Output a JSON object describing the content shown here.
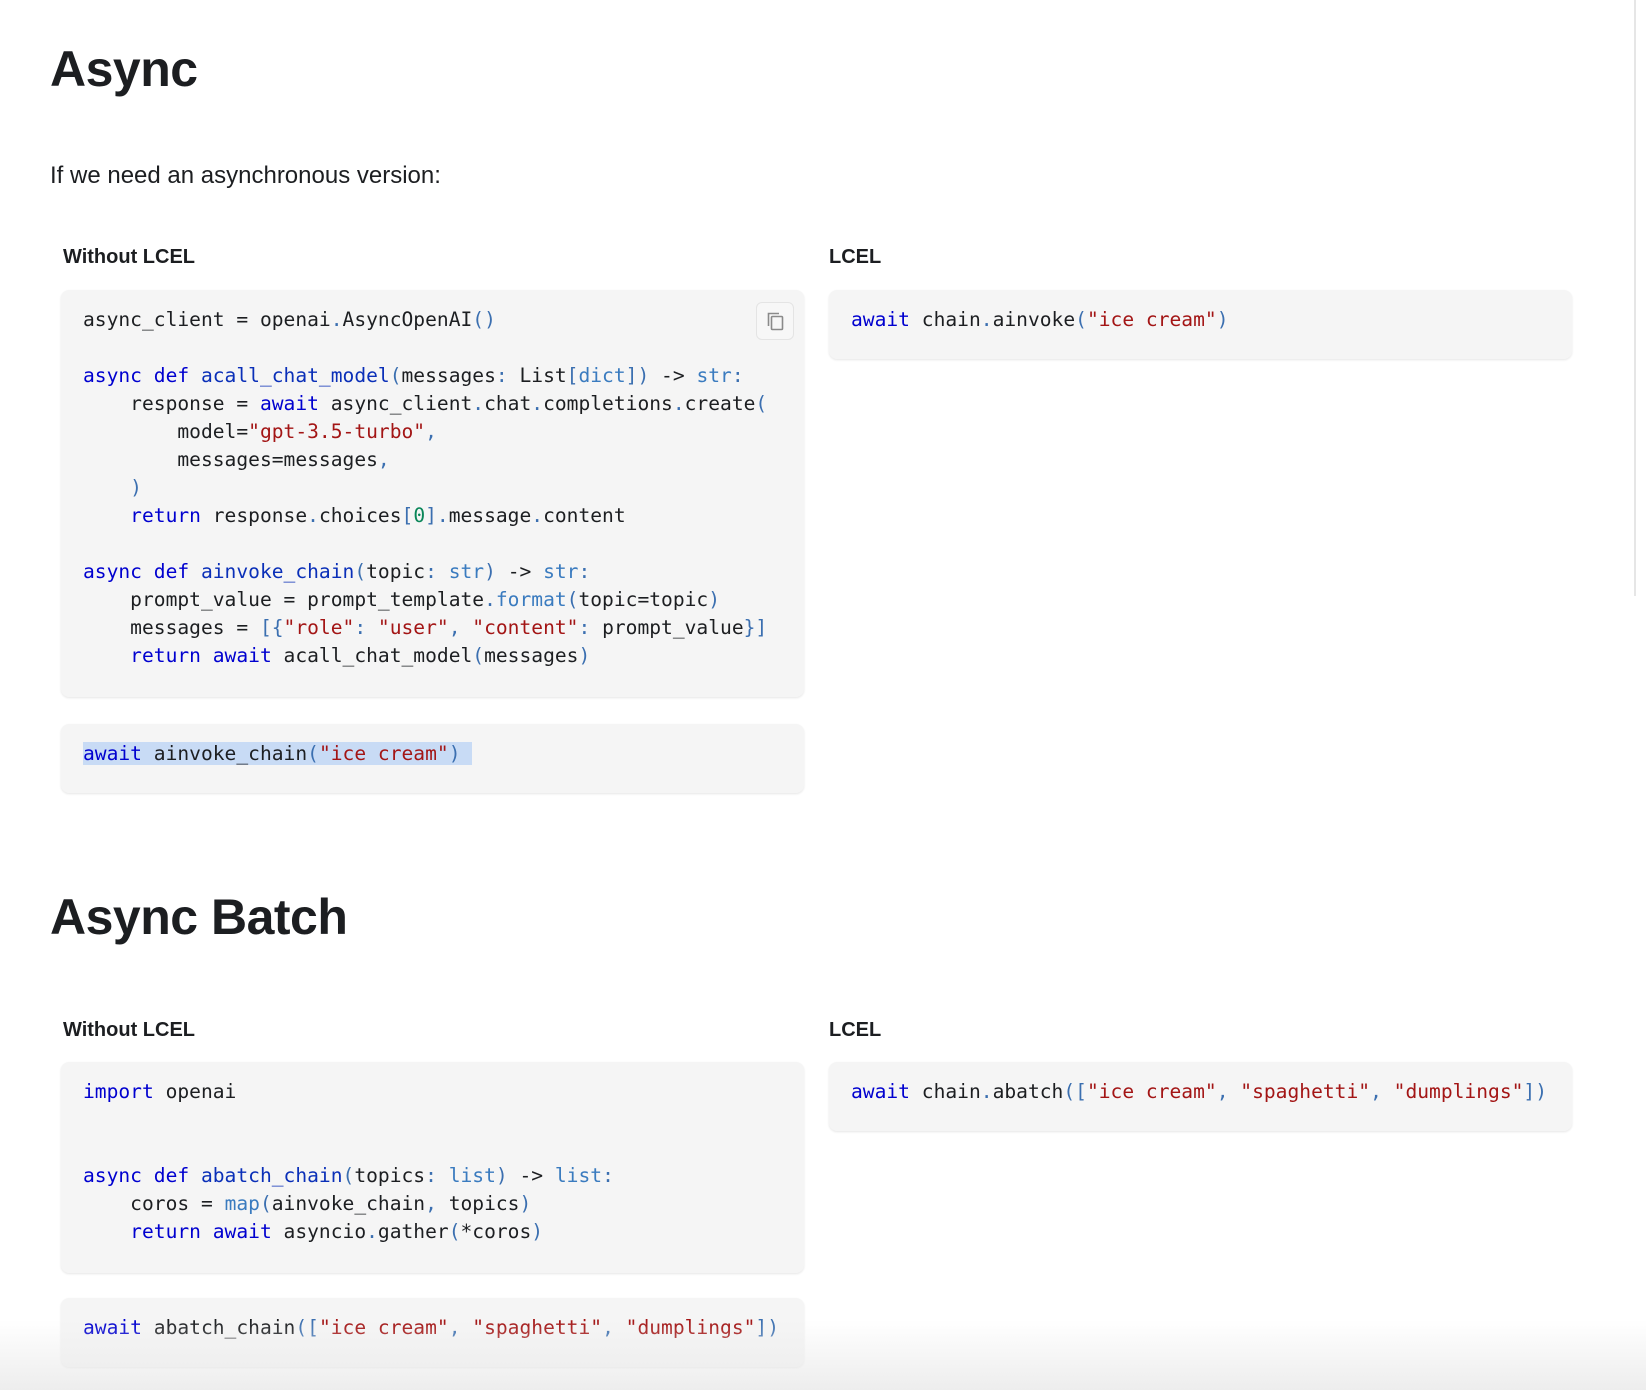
{
  "sections": {
    "async": {
      "title": "Async",
      "intro": "If we need an asynchronous version:",
      "without_label": "Without LCEL",
      "lcel_label": "LCEL"
    },
    "async_batch": {
      "title": "Async Batch",
      "without_label": "Without LCEL",
      "lcel_label": "LCEL"
    }
  },
  "code_blocks": {
    "async_without_lcel": [
      [
        [
          "t",
          "async_client = openai"
        ],
        [
          "p",
          "."
        ],
        [
          "t",
          "AsyncOpenAI"
        ],
        [
          "p",
          "()"
        ]
      ],
      [],
      [
        [
          "k",
          "async def "
        ],
        [
          "f",
          "acall_chat_model"
        ],
        [
          "p",
          "("
        ],
        [
          "t",
          "messages"
        ],
        [
          "p",
          ": "
        ],
        [
          "t",
          "List"
        ],
        [
          "p",
          "["
        ],
        [
          "b",
          "dict"
        ],
        [
          "p",
          "]) "
        ],
        [
          "t",
          "-> "
        ],
        [
          "b",
          "str"
        ],
        [
          "p",
          ":"
        ]
      ],
      [
        [
          "t",
          "    response = "
        ],
        [
          "k",
          "await "
        ],
        [
          "t",
          "async_client"
        ],
        [
          "p",
          "."
        ],
        [
          "t",
          "chat"
        ],
        [
          "p",
          "."
        ],
        [
          "t",
          "completions"
        ],
        [
          "p",
          "."
        ],
        [
          "t",
          "create"
        ],
        [
          "p",
          "("
        ]
      ],
      [
        [
          "t",
          "        model="
        ],
        [
          "s",
          "\"gpt-3.5-turbo\""
        ],
        [
          "p",
          ","
        ]
      ],
      [
        [
          "t",
          "        messages=messages"
        ],
        [
          "p",
          ","
        ]
      ],
      [
        [
          "p",
          "    )"
        ]
      ],
      [
        [
          "k",
          "    return "
        ],
        [
          "t",
          "response"
        ],
        [
          "p",
          "."
        ],
        [
          "t",
          "choices"
        ],
        [
          "p",
          "["
        ],
        [
          "n",
          "0"
        ],
        [
          "p",
          "]."
        ],
        [
          "t",
          "message"
        ],
        [
          "p",
          "."
        ],
        [
          "t",
          "content"
        ]
      ],
      [],
      [
        [
          "k",
          "async def "
        ],
        [
          "f",
          "ainvoke_chain"
        ],
        [
          "p",
          "("
        ],
        [
          "t",
          "topic"
        ],
        [
          "p",
          ": "
        ],
        [
          "b",
          "str"
        ],
        [
          "p",
          ") "
        ],
        [
          "t",
          "-> "
        ],
        [
          "b",
          "str"
        ],
        [
          "p",
          ":"
        ]
      ],
      [
        [
          "t",
          "    prompt_value = prompt_template"
        ],
        [
          "p",
          "."
        ],
        [
          "b",
          "format"
        ],
        [
          "p",
          "("
        ],
        [
          "t",
          "topic=topic"
        ],
        [
          "p",
          ")"
        ]
      ],
      [
        [
          "t",
          "    messages = "
        ],
        [
          "p",
          "[{"
        ],
        [
          "s",
          "\"role\""
        ],
        [
          "p",
          ": "
        ],
        [
          "s",
          "\"user\""
        ],
        [
          "p",
          ", "
        ],
        [
          "s",
          "\"content\""
        ],
        [
          "p",
          ": "
        ],
        [
          "t",
          "prompt_value"
        ],
        [
          "p",
          "}]"
        ]
      ],
      [
        [
          "k",
          "    return await "
        ],
        [
          "t",
          "acall_chat_model"
        ],
        [
          "p",
          "("
        ],
        [
          "t",
          "messages"
        ],
        [
          "p",
          ")"
        ]
      ]
    ],
    "async_without_lcel_call": [
      [
        [
          "k",
          "await "
        ],
        [
          "t",
          "ainvoke_chain"
        ],
        [
          "p",
          "("
        ],
        [
          "s",
          "\"ice cream\""
        ],
        [
          "p",
          ")"
        ],
        [
          "t",
          " "
        ]
      ]
    ],
    "async_lcel": [
      [
        [
          "k",
          "await "
        ],
        [
          "t",
          "chain"
        ],
        [
          "p",
          "."
        ],
        [
          "t",
          "ainvoke"
        ],
        [
          "p",
          "("
        ],
        [
          "s",
          "\"ice cream\""
        ],
        [
          "p",
          ")"
        ]
      ]
    ],
    "batch_without_lcel": [
      [
        [
          "k",
          "import "
        ],
        [
          "t",
          "openai"
        ]
      ],
      [],
      [],
      [
        [
          "k",
          "async def "
        ],
        [
          "f",
          "abatch_chain"
        ],
        [
          "p",
          "("
        ],
        [
          "t",
          "topics"
        ],
        [
          "p",
          ": "
        ],
        [
          "b",
          "list"
        ],
        [
          "p",
          ") "
        ],
        [
          "t",
          "-> "
        ],
        [
          "b",
          "list"
        ],
        [
          "p",
          ":"
        ]
      ],
      [
        [
          "t",
          "    coros = "
        ],
        [
          "b",
          "map"
        ],
        [
          "p",
          "("
        ],
        [
          "t",
          "ainvoke_chain"
        ],
        [
          "p",
          ", "
        ],
        [
          "t",
          "topics"
        ],
        [
          "p",
          ")"
        ]
      ],
      [
        [
          "k",
          "    return await "
        ],
        [
          "t",
          "asyncio"
        ],
        [
          "p",
          "."
        ],
        [
          "t",
          "gather"
        ],
        [
          "p",
          "("
        ],
        [
          "t",
          "*coros"
        ],
        [
          "p",
          ")"
        ]
      ]
    ],
    "batch_without_lcel_call": [
      [
        [
          "k",
          "await "
        ],
        [
          "t",
          "abatch_chain"
        ],
        [
          "p",
          "(["
        ],
        [
          "s",
          "\"ice cream\""
        ],
        [
          "p",
          ", "
        ],
        [
          "s",
          "\"spaghetti\""
        ],
        [
          "p",
          ", "
        ],
        [
          "s",
          "\"dumplings\""
        ],
        [
          "p",
          "])"
        ]
      ]
    ],
    "batch_lcel": [
      [
        [
          "k",
          "await "
        ],
        [
          "t",
          "chain"
        ],
        [
          "p",
          "."
        ],
        [
          "t",
          "abatch"
        ],
        [
          "p",
          "(["
        ],
        [
          "s",
          "\"ice cream\""
        ],
        [
          "p",
          ", "
        ],
        [
          "s",
          "\"spaghetti\""
        ],
        [
          "p",
          ", "
        ],
        [
          "s",
          "\"dumplings\""
        ],
        [
          "p",
          "])"
        ]
      ]
    ]
  },
  "icons": {
    "copy_button": "copy-icon"
  }
}
